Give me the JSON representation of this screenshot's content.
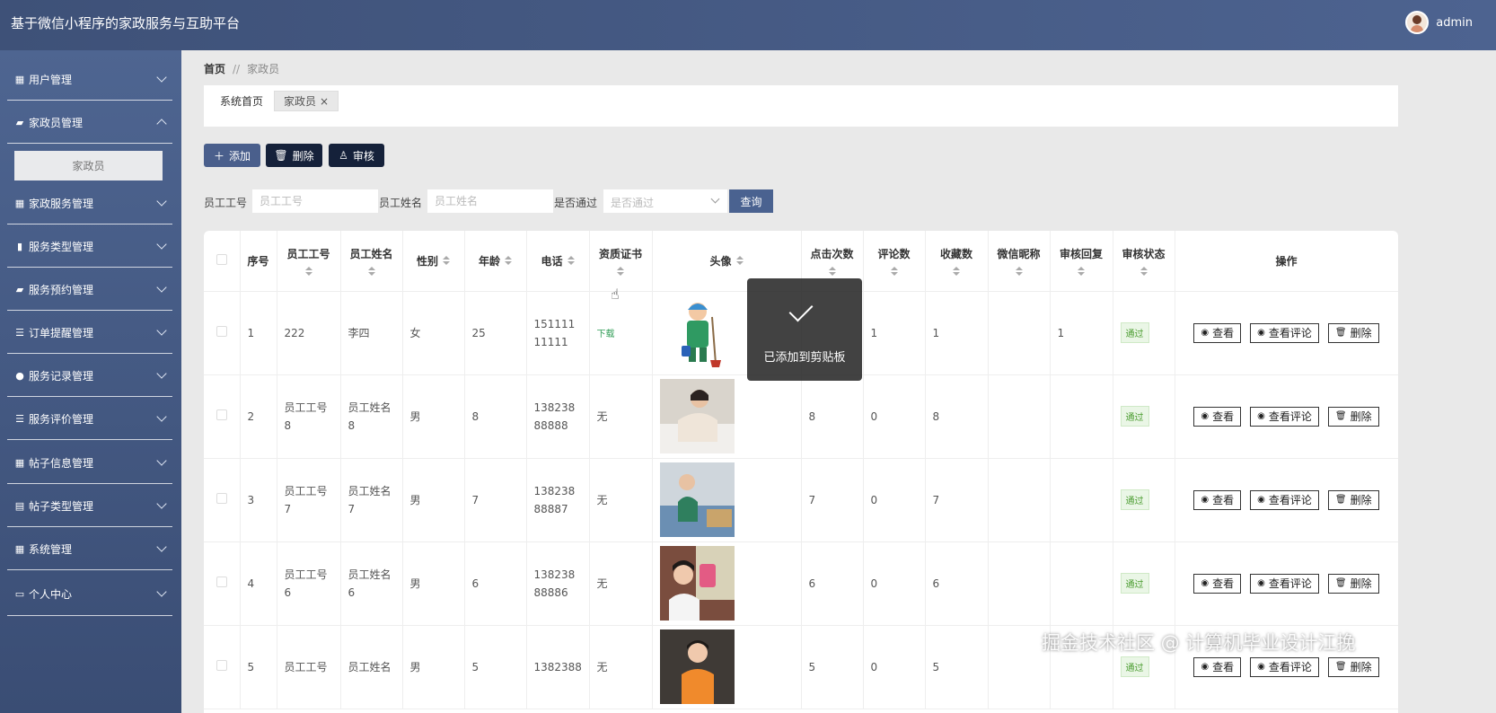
{
  "app": {
    "title": "基于微信小程序的家政服务与互助平台",
    "username": "admin"
  },
  "sidebar": {
    "items": [
      {
        "label": "用户管理",
        "icon": "grid-icon"
      },
      {
        "label": "家政员管理",
        "icon": "briefcase-icon"
      },
      {
        "label": "家政服务管理",
        "icon": "grid-icon"
      },
      {
        "label": "服务类型管理",
        "icon": "chart-icon"
      },
      {
        "label": "服务预约管理",
        "icon": "briefcase-icon"
      },
      {
        "label": "订单提醒管理",
        "icon": "sliders-icon"
      },
      {
        "label": "服务记录管理",
        "icon": "bulb-icon"
      },
      {
        "label": "服务评价管理",
        "icon": "list-icon"
      },
      {
        "label": "帖子信息管理",
        "icon": "grid-icon"
      },
      {
        "label": "帖子类型管理",
        "icon": "clipboard-icon"
      },
      {
        "label": "系统管理",
        "icon": "grid-icon"
      },
      {
        "label": "个人中心",
        "icon": "card-icon"
      }
    ],
    "submenu_active": "家政员"
  },
  "breadcrumb": {
    "home": "首页",
    "sep": "//",
    "current": "家政员"
  },
  "tabs": {
    "home": "系统首页",
    "current": "家政员",
    "close": "×"
  },
  "toolbar": {
    "add": "添加",
    "delete": "删除",
    "audit": "审核"
  },
  "search": {
    "employee_no_label": "员工工号",
    "employee_no_placeholder": "员工工号",
    "employee_name_label": "员工姓名",
    "employee_name_placeholder": "员工姓名",
    "passed_label": "是否通过",
    "passed_placeholder": "是否通过",
    "query": "查询"
  },
  "table": {
    "headers": {
      "index": "序号",
      "employee_no": "员工工号",
      "employee_name": "员工姓名",
      "gender": "性别",
      "age": "年龄",
      "phone": "电话",
      "certificate": "资质证书",
      "avatar": "头像",
      "clicks": "点击次数",
      "comments": "评论数",
      "favorites": "收藏数",
      "wechat_nick": "微信昵称",
      "audit_reply": "审核回复",
      "audit_status": "审核状态",
      "actions": "操作"
    },
    "rows": [
      {
        "index": "1",
        "no": "222",
        "name": "李四",
        "gender": "女",
        "age": "25",
        "phone": "15111111111",
        "cert": "下载",
        "clicks": "",
        "comments": "1",
        "favorites": "1",
        "nick": "",
        "reply": "1",
        "status": "通过"
      },
      {
        "index": "2",
        "no": "员工工号8",
        "name": "员工姓名8",
        "gender": "男",
        "age": "8",
        "phone": "13823888888",
        "cert": "无",
        "clicks": "8",
        "comments": "0",
        "favorites": "8",
        "nick": "",
        "reply": "",
        "status": "通过"
      },
      {
        "index": "3",
        "no": "员工工号7",
        "name": "员工姓名7",
        "gender": "男",
        "age": "7",
        "phone": "13823888887",
        "cert": "无",
        "clicks": "7",
        "comments": "0",
        "favorites": "7",
        "nick": "",
        "reply": "",
        "status": "通过"
      },
      {
        "index": "4",
        "no": "员工工号6",
        "name": "员工姓名6",
        "gender": "男",
        "age": "6",
        "phone": "13823888886",
        "cert": "无",
        "clicks": "6",
        "comments": "0",
        "favorites": "6",
        "nick": "",
        "reply": "",
        "status": "通过"
      },
      {
        "index": "5",
        "no": "员工工号",
        "name": "员工姓名",
        "gender": "男",
        "age": "5",
        "phone": "1382388",
        "cert": "无",
        "clicks": "5",
        "comments": "0",
        "favorites": "5",
        "nick": "",
        "reply": "",
        "status": "通过"
      }
    ],
    "actions": {
      "view": "查看",
      "view_comments": "查看评论",
      "delete": "删除"
    }
  },
  "toast": {
    "text": "已添加到剪贴板"
  },
  "watermark": "掘金技术社区 @ 计算机毕业设计江挽"
}
